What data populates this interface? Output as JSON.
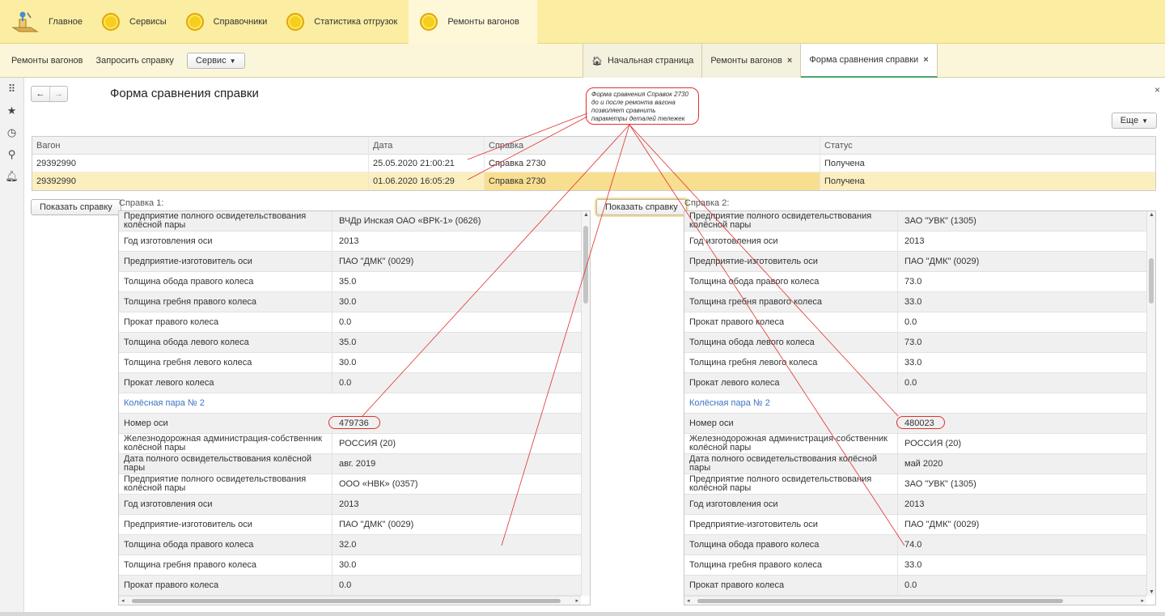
{
  "sections": [
    {
      "label": "Главное",
      "icon": "home-logo-icon"
    },
    {
      "label": "Сервисы",
      "icon": "section-circle-icon"
    },
    {
      "label": "Справочники",
      "icon": "section-circle-icon"
    },
    {
      "label": "Статистика отгрузок",
      "icon": "section-circle-icon"
    },
    {
      "label": "Ремонты вагонов",
      "icon": "section-circle-icon",
      "active": true
    }
  ],
  "nav": {
    "cmd1": "Ремонты вагонов",
    "cmd2": "Запросить справку",
    "service": "Сервис"
  },
  "tabs": [
    {
      "label": "Начальная страница"
    },
    {
      "label": "Ремонты вагонов"
    },
    {
      "label": "Форма сравнения справки",
      "active": true
    }
  ],
  "form": {
    "title": "Форма сравнения справки",
    "more": "Еще",
    "annotation": "Форма сравнения Справок 2730 до и после ремонта вагона позволяет сравнить параметры деталей тележек"
  },
  "grid": {
    "headers": [
      "Вагон",
      "Дата",
      "Справка",
      "Статус"
    ],
    "rows": [
      [
        "29392990",
        "25.05.2020 21:00:21",
        "Справка 2730",
        "Получена"
      ],
      [
        "29392990",
        "01.06.2020 16:05:29",
        "Справка 2730",
        "Получена"
      ]
    ]
  },
  "show_button": "Показать справку",
  "left_panel": {
    "label": "Справка 1:",
    "rows": [
      {
        "k": "Предприятие полного освидетельствования колёсной пары",
        "v": "ВЧДр Инская ОАО «ВРК-1» (0626)"
      },
      {
        "k": "Год изготовления оси",
        "v": "2013"
      },
      {
        "k": "Предприятие-изготовитель оси",
        "v": "ПАО \"ДМК\" (0029)"
      },
      {
        "k": "Толщина обода правого колеса",
        "v": "35.0"
      },
      {
        "k": "Толщина гребня правого колеса",
        "v": "30.0"
      },
      {
        "k": "Прокат правого колеса",
        "v": "0.0"
      },
      {
        "k": "Толщина обода левого колеса",
        "v": "35.0"
      },
      {
        "k": "Толщина гребня левого колеса",
        "v": "30.0"
      },
      {
        "k": "Прокат левого колеса",
        "v": "0.0"
      },
      {
        "k": "Колёсная пара № 2",
        "v": "",
        "group": true
      },
      {
        "k": "Номер оси",
        "v": "479736"
      },
      {
        "k": "Железнодорожная администрация-собственник колёсной пары",
        "v": "РОССИЯ (20)"
      },
      {
        "k": "Дата полного освидетельствования колёсной пары",
        "v": "авг. 2019"
      },
      {
        "k": "Предприятие полного освидетельствования колёсной пары",
        "v": "ООО «НВК» (0357)"
      },
      {
        "k": "Год изготовления оси",
        "v": "2013"
      },
      {
        "k": "Предприятие-изготовитель оси",
        "v": "ПАО \"ДМК\" (0029)"
      },
      {
        "k": "Толщина обода правого колеса",
        "v": "32.0"
      },
      {
        "k": "Толщина гребня правого колеса",
        "v": "30.0"
      },
      {
        "k": "Прокат правого колеса",
        "v": "0.0"
      }
    ]
  },
  "right_panel": {
    "label": "Справка 2:",
    "rows": [
      {
        "k": "Предприятие полного освидетельствования колёсной пары",
        "v": "ЗАО \"УВК\" (1305)"
      },
      {
        "k": "Год изготовления оси",
        "v": "2013"
      },
      {
        "k": "Предприятие-изготовитель оси",
        "v": "ПАО \"ДМК\" (0029)"
      },
      {
        "k": "Толщина обода правого колеса",
        "v": "73.0"
      },
      {
        "k": "Толщина гребня правого колеса",
        "v": "33.0"
      },
      {
        "k": "Прокат правого колеса",
        "v": "0.0"
      },
      {
        "k": "Толщина обода левого колеса",
        "v": "73.0"
      },
      {
        "k": "Толщина гребня левого колеса",
        "v": "33.0"
      },
      {
        "k": "Прокат левого колеса",
        "v": "0.0"
      },
      {
        "k": "Колёсная пара № 2",
        "v": "",
        "group": true
      },
      {
        "k": "Номер оси",
        "v": "480023"
      },
      {
        "k": "Железнодорожная администрация-собственник колёсной пары",
        "v": "РОССИЯ (20)"
      },
      {
        "k": "Дата полного освидетельствования колёсной пары",
        "v": "май 2020"
      },
      {
        "k": "Предприятие полного освидетельствования колёсной пары",
        "v": "ЗАО \"УВК\" (1305)"
      },
      {
        "k": "Год изготовления оси",
        "v": "2013"
      },
      {
        "k": "Предприятие-изготовитель оси",
        "v": "ПАО \"ДМК\" (0029)"
      },
      {
        "k": "Толщина обода правого колеса",
        "v": "74.0"
      },
      {
        "k": "Толщина гребня правого колеса",
        "v": "33.0"
      },
      {
        "k": "Прокат правого колеса",
        "v": "0.0"
      }
    ]
  },
  "left_tools": [
    "apps-grid-icon",
    "star-icon",
    "history-icon",
    "search-icon",
    "bell-icon"
  ]
}
